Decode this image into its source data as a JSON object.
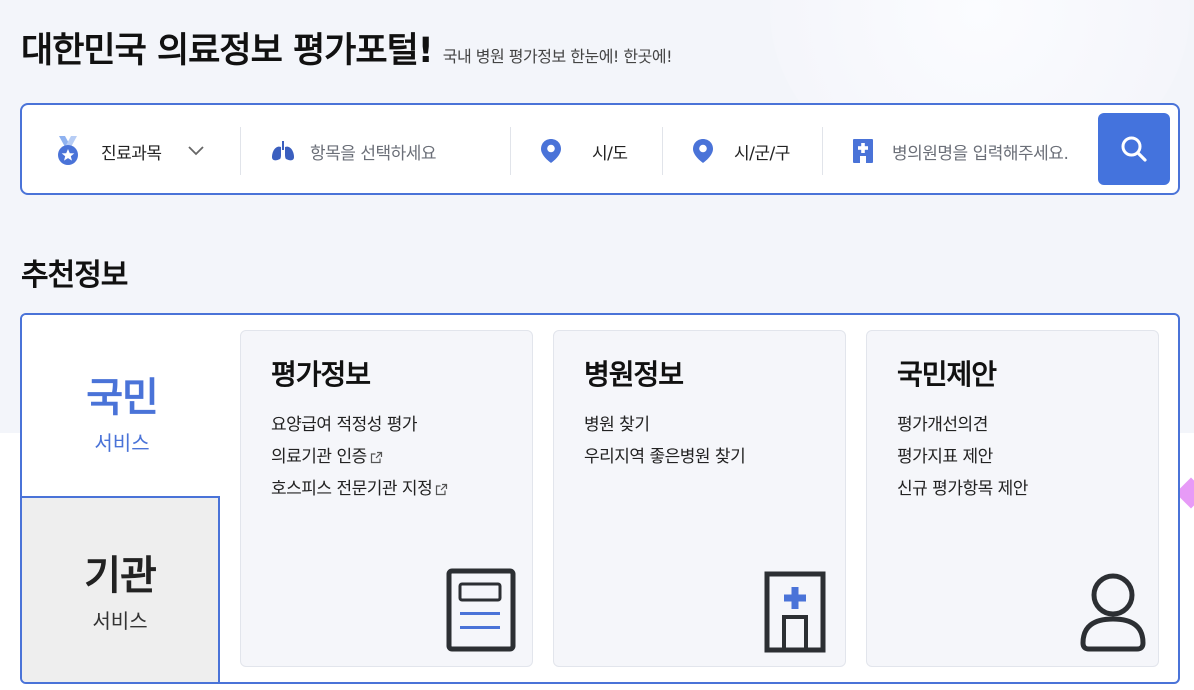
{
  "header": {
    "title": "대한민국 의료정보 평가포털!",
    "subtitle": "국내 병원 평가정보 한눈에! 한곳에!"
  },
  "search": {
    "department_label": "진료과목",
    "item_placeholder": "항목을 선택하세요",
    "sido_label": "시/도",
    "sigungu_label": "시/군/구",
    "hospital_placeholder": "병의원명을 입력해주세요."
  },
  "recommend": {
    "section_title": "추천정보",
    "tabs": {
      "citizen": {
        "big": "국민",
        "small": "서비스"
      },
      "org": {
        "big": "기관",
        "small": "서비스"
      }
    },
    "cards": [
      {
        "title": "평가정보",
        "links": [
          "요양급여 적정성 평가",
          "의료기관 인증",
          "호스피스 전문기관 지정"
        ]
      },
      {
        "title": "병원정보",
        "links": [
          "병원 찾기",
          "우리지역 좋은병원 찾기"
        ]
      },
      {
        "title": "국민제안",
        "links": [
          "평가개선의견",
          "평가지표 제안",
          "신규 평가항목 제안"
        ]
      }
    ]
  },
  "colors": {
    "accent": "#4a73d8",
    "search_button": "#4473dd",
    "background": "#f3f5fa"
  },
  "icons": {
    "department": "medal-icon",
    "item": "lungs-icon",
    "location": "map-pin-icon",
    "hospital": "hospital-sign-icon",
    "search": "search-icon",
    "external": "external-link-icon"
  }
}
